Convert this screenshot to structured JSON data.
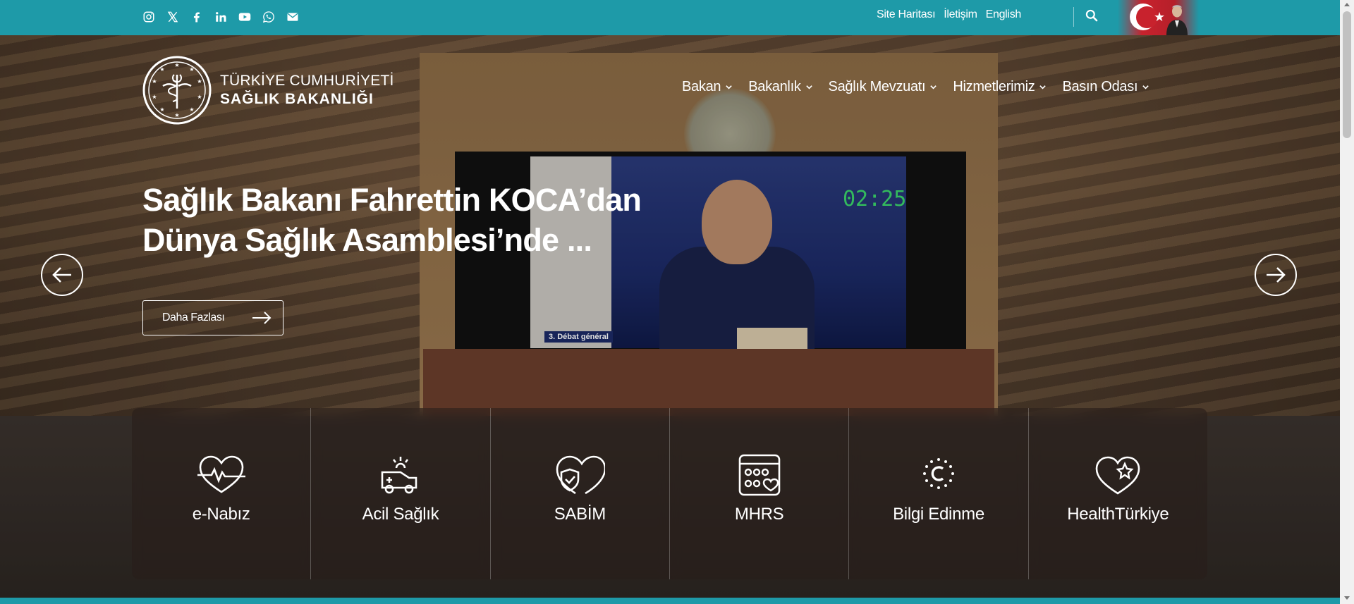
{
  "topbar": {
    "social_icons": [
      "instagram-icon",
      "x-icon",
      "facebook-icon",
      "linkedin-icon",
      "youtube-icon",
      "whatsapp-icon",
      "mail-icon"
    ],
    "links": [
      "Site Haritası",
      "İletişim",
      "English"
    ],
    "search_icon": "search-icon",
    "background": "#1e9aa8"
  },
  "brand": {
    "line1": "TÜRKİYE CUMHURİYETİ",
    "line2": "SAĞLIK BAKANLIĞI"
  },
  "nav": {
    "items": [
      "Bakan",
      "Bakanlık",
      "Sağlık Mevzuatı",
      "Hizmetlerimiz",
      "Basın Odası"
    ]
  },
  "hero": {
    "headline_line1": "Sağlık Bakanı Fahrettin KOCA’dan",
    "headline_line2": "Dünya Sağlık Asamblesi’nde ...",
    "more_label": "Daha Fazlası",
    "screen_timer": "02:25",
    "screen_caption": "3. Débat général"
  },
  "services": [
    {
      "label": "e-Nabız",
      "icon": "heart-pulse-icon"
    },
    {
      "label": "Acil Sağlık",
      "icon": "ambulance-icon"
    },
    {
      "label": "SABİM",
      "icon": "shield-heart-icon"
    },
    {
      "label": "MHRS",
      "icon": "calendar-heart-icon"
    },
    {
      "label": "Bilgi Edinme",
      "icon": "info-seal-icon"
    },
    {
      "label": "HealthTürkiye",
      "icon": "heart-star-icon"
    }
  ]
}
